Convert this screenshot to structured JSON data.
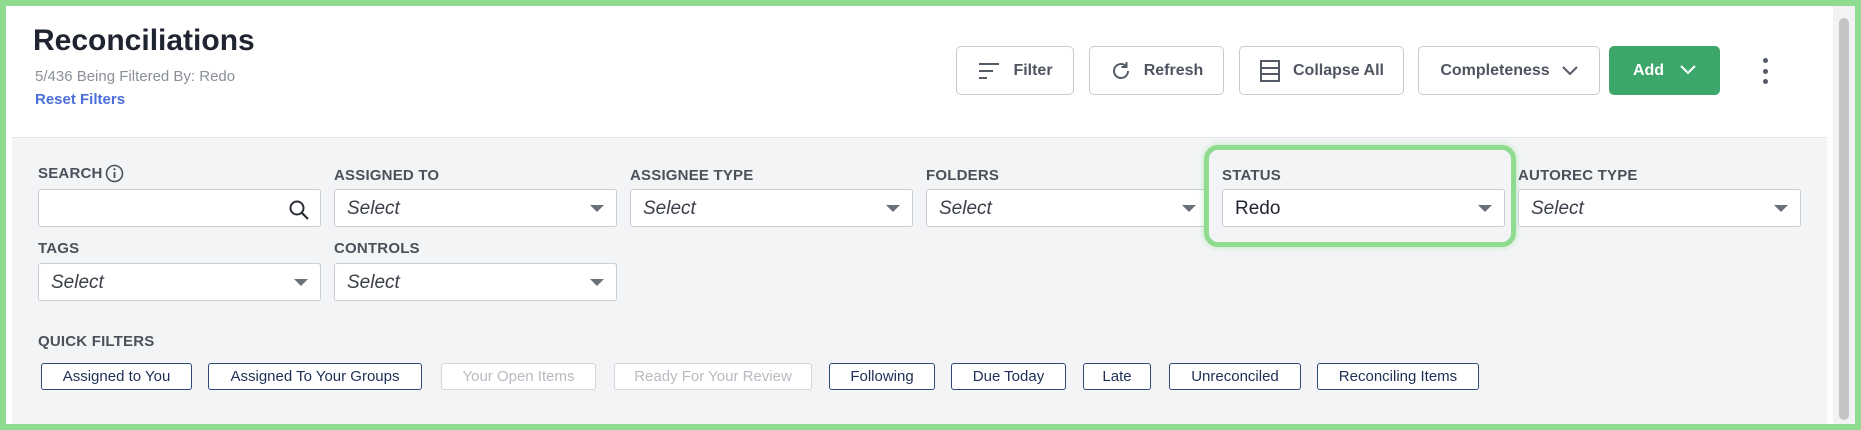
{
  "header": {
    "title": "Reconciliations",
    "filter_summary": "5/436 Being Filtered By: Redo",
    "reset_filters": "Reset Filters"
  },
  "toolbar": {
    "filter_label": "Filter",
    "refresh_label": "Refresh",
    "collapse_label": "Collapse All",
    "completeness_label": "Completeness",
    "add_label": "Add"
  },
  "filters": {
    "search_label": "SEARCH",
    "search_value": "",
    "assigned_to_label": "ASSIGNED TO",
    "assigned_to_value": "Select",
    "assignee_type_label": "ASSIGNEE TYPE",
    "assignee_type_value": "Select",
    "folders_label": "FOLDERS",
    "folders_value": "Select",
    "status_label": "STATUS",
    "status_value": "Redo",
    "autorec_type_label": "AUTOREC TYPE",
    "autorec_type_value": "Select",
    "tags_label": "TAGS",
    "tags_value": "Select",
    "controls_label": "CONTROLS",
    "controls_value": "Select"
  },
  "quick_filters": {
    "label": "QUICK FILTERS",
    "items": [
      {
        "label": "Assigned to You",
        "disabled": false
      },
      {
        "label": "Assigned To Your Groups",
        "disabled": false
      },
      {
        "label": "Your Open Items",
        "disabled": true
      },
      {
        "label": "Ready For Your Review",
        "disabled": true
      },
      {
        "label": "Following",
        "disabled": false
      },
      {
        "label": "Due Today",
        "disabled": false
      },
      {
        "label": "Late",
        "disabled": false
      },
      {
        "label": "Unreconciled",
        "disabled": false
      },
      {
        "label": "Reconciling Items",
        "disabled": false
      }
    ]
  },
  "colors": {
    "accent_green": "#3da66a",
    "highlight": "#8fdc91",
    "link_blue": "#4a6fd8",
    "chip_border": "#2f4a78"
  }
}
